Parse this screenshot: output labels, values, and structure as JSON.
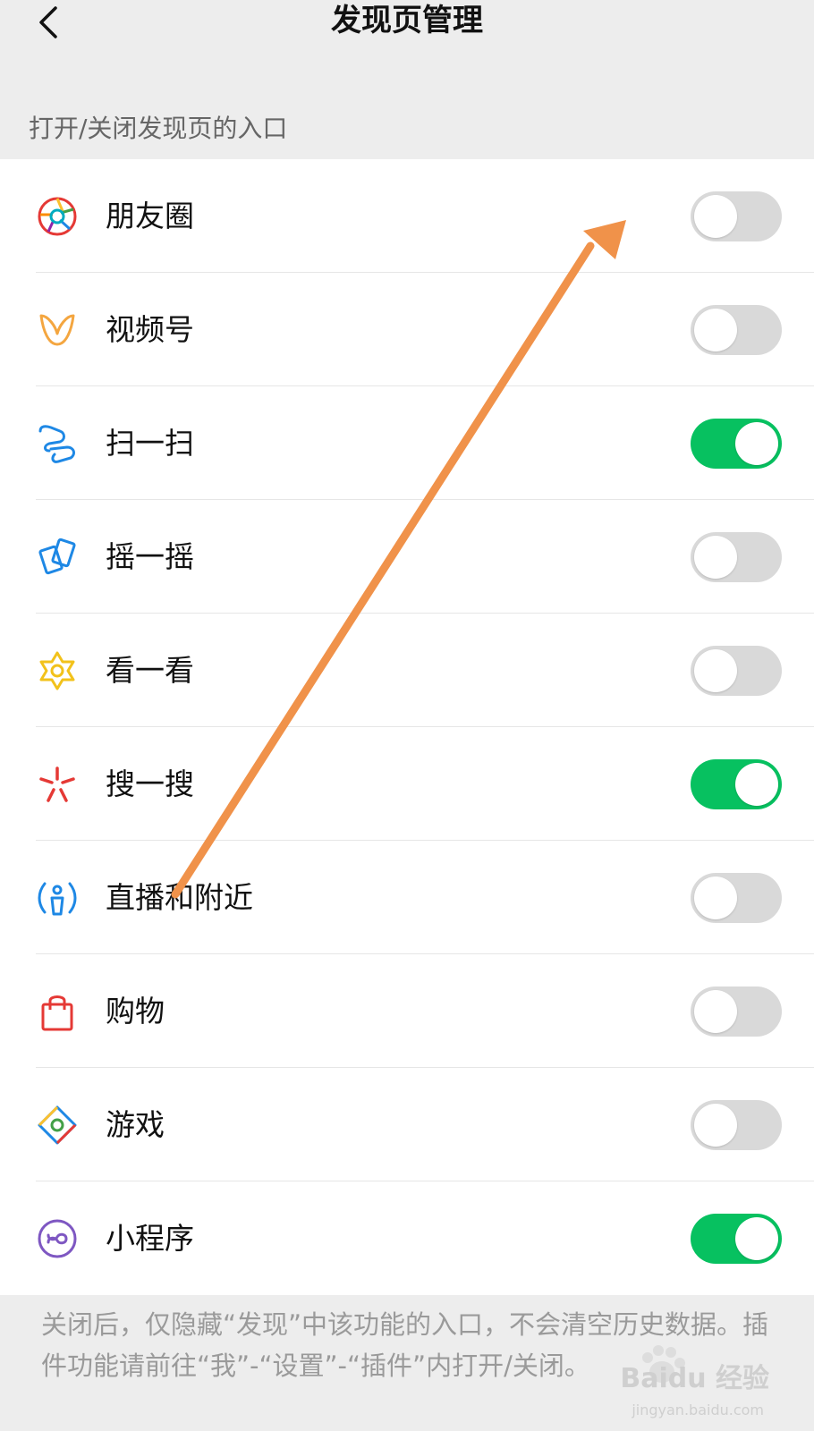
{
  "header": {
    "title": "发现页管理",
    "back_icon": "chevron-left-icon"
  },
  "section": {
    "label": "打开/关闭发现页的入口"
  },
  "items": [
    {
      "label": "朋友圈",
      "icon": "moments-aperture-icon",
      "enabled": false
    },
    {
      "label": "视频号",
      "icon": "channels-butterfly-icon",
      "enabled": false
    },
    {
      "label": "扫一扫",
      "icon": "scan-icon",
      "enabled": true
    },
    {
      "label": "摇一摇",
      "icon": "shake-icon",
      "enabled": false
    },
    {
      "label": "看一看",
      "icon": "top-stories-star-icon",
      "enabled": false
    },
    {
      "label": "搜一搜",
      "icon": "search-spark-icon",
      "enabled": true
    },
    {
      "label": "直播和附近",
      "icon": "live-nearby-icon",
      "enabled": false
    },
    {
      "label": "购物",
      "icon": "shopping-bag-icon",
      "enabled": false
    },
    {
      "label": "游戏",
      "icon": "games-diamond-icon",
      "enabled": false
    },
    {
      "label": "小程序",
      "icon": "mini-programs-icon",
      "enabled": true
    }
  ],
  "footer": {
    "note": "关闭后，仅隐藏“发现”中该功能的入口，不会清空历史数据。插件功能请前往“我”-“设置”-“插件”内打开/关闭。"
  },
  "watermark": {
    "brand": "Baidu 经验",
    "url": "jingyan.baidu.com"
  },
  "colors": {
    "toggle_on": "#07c160",
    "toggle_off": "#d9d9d9",
    "arrow": "#f0924a"
  }
}
